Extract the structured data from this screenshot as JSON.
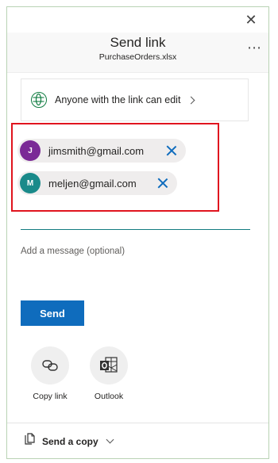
{
  "dialog": {
    "title": "Send link",
    "file_name": "PurchaseOrders.xlsx",
    "close_icon": "close-icon",
    "more_icon": "more-options-icon",
    "more_glyph": "⋯"
  },
  "permission": {
    "label": "Anyone with the link can edit",
    "icon": "globe-icon",
    "accent": "#107c41"
  },
  "recipients": [
    {
      "initial": "J",
      "email": "jimsmith@gmail.com",
      "avatar_color": "#7a2a96"
    },
    {
      "initial": "M",
      "email": "meljen@gmail.com",
      "avatar_color": "#1a8a8a"
    }
  ],
  "highlight_color": "#e0141e",
  "message": {
    "placeholder": "Add a message (optional)"
  },
  "send_button": {
    "label": "Send",
    "color": "#0f6cbd"
  },
  "actions": [
    {
      "label": "Copy link",
      "icon": "link-icon"
    },
    {
      "label": "Outlook",
      "icon": "outlook-icon"
    }
  ],
  "footer": {
    "label": "Send a copy",
    "icon": "copy-icon"
  }
}
